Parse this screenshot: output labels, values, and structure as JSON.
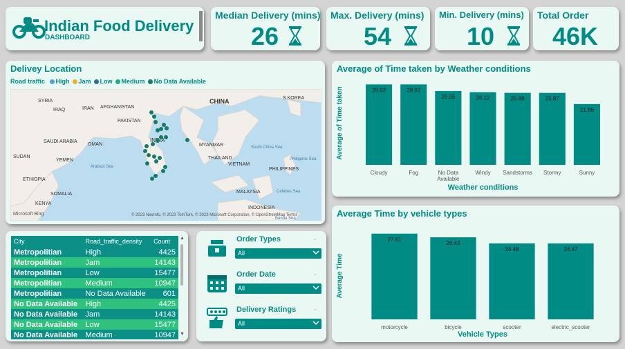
{
  "header": {
    "title": "Indian Food Delivery",
    "subtitle": "DASHBOARD",
    "logo_icon": "motorbike-icon"
  },
  "kpis": {
    "median": {
      "label": "Median Delivery (mins)",
      "value": "26"
    },
    "max": {
      "label": "Max. Delivery (mins)",
      "value": "54"
    },
    "min": {
      "label": "Min. Delivery (mins)",
      "value": "10"
    },
    "total": {
      "label": "Total Order",
      "value": "46K"
    }
  },
  "map": {
    "title": "Delivey Location",
    "legend_label": "Road traffic",
    "legend": [
      {
        "label": "High",
        "color": "#4fa0d8"
      },
      {
        "label": "Jam",
        "color": "#f2b02a"
      },
      {
        "label": "Low",
        "color": "#2e6f95"
      },
      {
        "label": "Medium",
        "color": "#22a98a"
      },
      {
        "label": "No Data Available",
        "color": "#157a66"
      }
    ],
    "countries": [
      "S KOREA",
      "SYRIA",
      "IRAQ",
      "IRAN",
      "AFGHANISTAN",
      "CHINA",
      "PAKISTAN",
      "SAUDI ARABIA",
      "OMAN",
      "INDIA",
      "MYANMAR",
      "SUDAN",
      "YEMEN",
      "THAILAND",
      "VIETNAM",
      "PHILIPPINES",
      "ETHIOPIA",
      "SOMALIA",
      "MALAYSIA",
      "KENYA",
      "INDONESIA"
    ],
    "seas": [
      "Arabian Sea",
      "Philippine Sea",
      "South China Sea",
      "Celebes Sea",
      "Banda Sea"
    ],
    "attribution": "© 2023 NavInfo, © 2023 TomTom, © 2023 Microsoft Corporation, © OpenStreetMap  Terms",
    "brand": "Microsoft Bing"
  },
  "weather_chart_title": "Average of Time taken by Weather conditions",
  "vehicle_chart_title": "Average Time by vehicle types",
  "chart_data": [
    {
      "type": "bar",
      "title": "Average of Time taken by Weather conditions",
      "xlabel": "Weather conditions",
      "ylabel": "Average of Time taken",
      "categories": [
        "Cloudy",
        "Fog",
        "No Data Available",
        "Windy",
        "Sandstorms",
        "Stormy",
        "Sunny"
      ],
      "values": [
        28.92,
        28.92,
        26.55,
        26.12,
        25.88,
        25.87,
        21.86
      ],
      "ylim": [
        0,
        30
      ],
      "color": "#008b85"
    },
    {
      "type": "bar",
      "title": "Average Time by vehicle types",
      "xlabel": "Vehicle Types",
      "ylabel": "Average Time",
      "categories": [
        "motorcycle",
        "bicycle",
        "scooter",
        "electric_scooter"
      ],
      "values": [
        27.61,
        26.43,
        24.48,
        24.47
      ],
      "ylim": [
        0,
        28
      ],
      "color": "#008b85"
    }
  ],
  "table": {
    "headers": [
      "City",
      "Road_traffic_density",
      "Count"
    ],
    "rows": [
      [
        "Metropolitian",
        "High",
        "4425"
      ],
      [
        "Metropolitian",
        "Jam",
        "14143"
      ],
      [
        "Metropolitian",
        "Low",
        "15477"
      ],
      [
        "Metropolitian",
        "Medium",
        "10947"
      ],
      [
        "Metropolitian",
        "No Data Available",
        "601"
      ],
      [
        "No Data Available",
        "High",
        "4425"
      ],
      [
        "No Data Available",
        "Jam",
        "14143"
      ],
      [
        "No Data Available",
        "Low",
        "15477"
      ],
      [
        "No Data Available",
        "Medium",
        "10947"
      ]
    ]
  },
  "slicers": [
    {
      "label": "Order Types",
      "value": "All",
      "icon": "food-order-icon"
    },
    {
      "label": "Order Date",
      "value": "All",
      "icon": "calendar-icon"
    },
    {
      "label": "Delivery Ratings",
      "value": "All",
      "icon": "rating-icon"
    }
  ],
  "colors": {
    "accent": "#008b85",
    "background": "#eaf8f3",
    "row_light": "#2ec27e",
    "row_dark": "#0b8f86"
  }
}
